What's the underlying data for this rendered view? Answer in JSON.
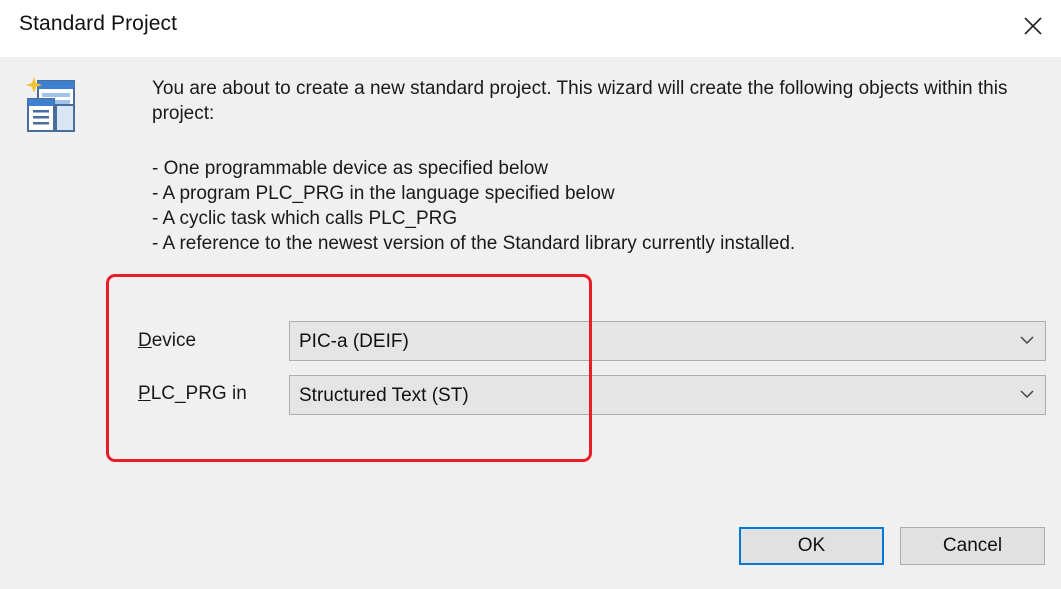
{
  "window": {
    "title": "Standard Project"
  },
  "intro": {
    "text": "You are about to create a new standard project. This wizard will create the following objects within this project:",
    "bullets": [
      "- One programmable device as specified below",
      "- A program PLC_PRG in the language specified below",
      "- A cyclic task which calls PLC_PRG",
      "- A reference to the newest version of the Standard library currently installed."
    ]
  },
  "form": {
    "device": {
      "label_mnemonic": "D",
      "label_rest": "evice",
      "value": "PIC-a (DEIF)"
    },
    "plc_prg": {
      "label_mnemonic": "P",
      "label_rest": "LC_PRG in",
      "value": "Structured Text (ST)"
    }
  },
  "buttons": {
    "ok": "OK",
    "cancel": "Cancel"
  },
  "colors": {
    "highlight": "#ea1c25",
    "default_button_border": "#0078d7",
    "content_background": "#f0f0f0"
  },
  "icons": {
    "close": "close-icon",
    "wizard": "project-wizard-icon",
    "dropdown": "chevron-down-icon"
  }
}
